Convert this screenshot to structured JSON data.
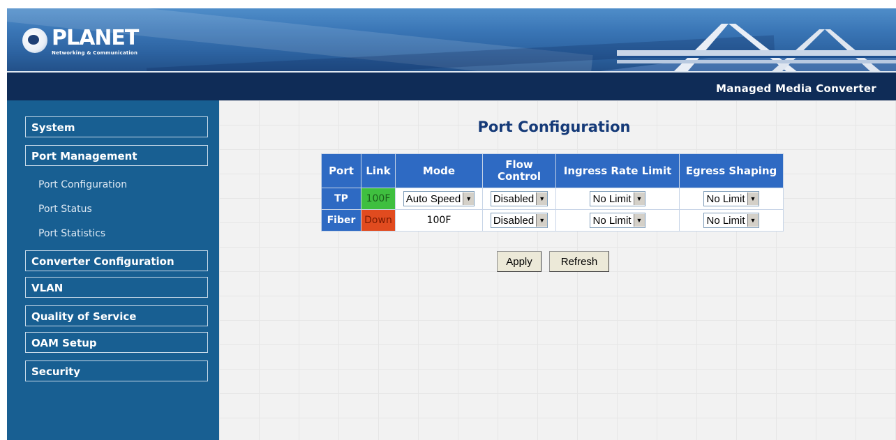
{
  "header": {
    "brand": "PLANET",
    "tagline": "Networking & Communication",
    "product": "Managed Media Converter"
  },
  "sidebar": {
    "items": [
      {
        "label": "System"
      },
      {
        "label": "Port Management"
      },
      {
        "label": "Converter Configuration"
      },
      {
        "label": "VLAN"
      },
      {
        "label": "Quality of Service"
      },
      {
        "label": "OAM Setup"
      },
      {
        "label": "Security"
      }
    ],
    "sub_items": [
      {
        "label": "Port Configuration"
      },
      {
        "label": "Port Status"
      },
      {
        "label": "Port Statistics"
      }
    ]
  },
  "main": {
    "title": "Port Configuration",
    "table": {
      "headers": [
        "Port",
        "Link",
        "Mode",
        "Flow Control",
        "Ingress Rate Limit",
        "Egress Shaping"
      ],
      "rows": [
        {
          "port": "TP",
          "link": "100F",
          "link_color": "#3fbf3f",
          "mode": "Auto Speed",
          "flow": "Disabled",
          "ingress": "No Limit",
          "egress": "No Limit"
        },
        {
          "port": "Fiber",
          "link": "Down",
          "link_color": "#e14b1f",
          "mode": "100F",
          "flow": "Disabled",
          "ingress": "No Limit",
          "egress": "No Limit"
        }
      ]
    },
    "buttons": {
      "apply": "Apply",
      "refresh": "Refresh"
    }
  },
  "colors": {
    "sidebar": "#185f92",
    "titlebar": "#0f2c57",
    "table_header": "#2e6ac3",
    "title_text": "#153a78"
  },
  "icons": {
    "dropdown": "triangle-down-icon"
  }
}
